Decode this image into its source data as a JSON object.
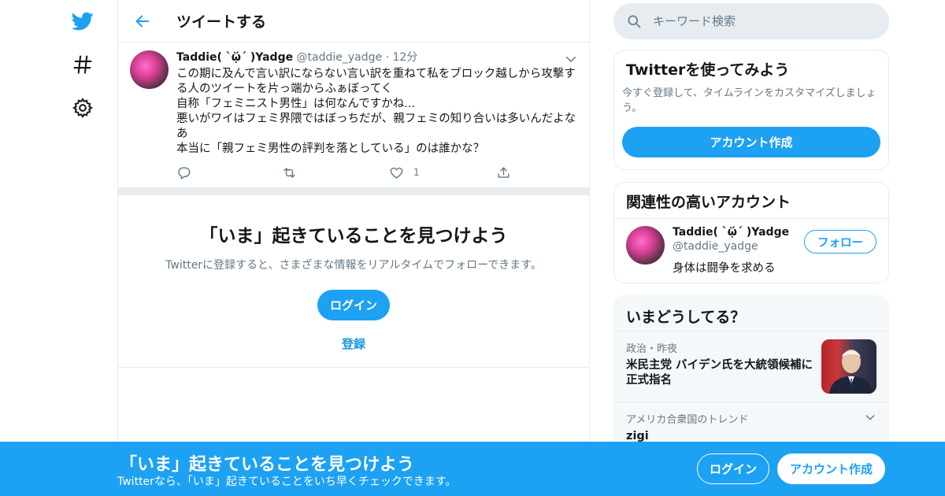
{
  "nav": {
    "icons": [
      "twitter-bird-icon",
      "hashtag-icon",
      "gear-icon"
    ]
  },
  "header": {
    "title": "ツイートする",
    "back_icon": "back-arrow-icon"
  },
  "tweet": {
    "author_name": "Taddie( ˋᾥˊ )Yadge",
    "handle": "@taddie_yadge",
    "separator": "·",
    "time": "12分",
    "lines": [
      "この期に及んで言い訳にならない言い訳を重ねて私をブロック越しから攻撃する人のツイートを片っ端からふぁぼってく",
      "自称「フェミニスト男性」は何なんですかね...",
      "悪いがワイはフェミ界隈ではぼっちだが、親フェミの知り合いは多いんだよなあ",
      "本当に「親フェミ男性の評判を落としている」のは誰かな？"
    ],
    "like_count": "1"
  },
  "discover": {
    "title": "「いま」起きていることを見つけよう",
    "subtitle": "Twitterに登録すると、さまざまな情報をリアルタイムでフォローできます。",
    "login_label": "ログイン",
    "register_label": "登録"
  },
  "search": {
    "placeholder": "キーワード検索"
  },
  "try_card": {
    "title": "Twitterを使ってみよう",
    "text": "今すぐ登録して、タイムラインをカスタマイズしましょう。",
    "button": "アカウント作成"
  },
  "related": {
    "title": "関連性の高いアカウント",
    "name": "Taddie( ˋᾥˊ )Yadge",
    "handle": "@taddie_yadge",
    "bio": "身体は闘争を求める",
    "follow_label": "フォロー"
  },
  "trends": {
    "title": "いまどうしてる？",
    "items": [
      {
        "category": "政治・昨夜",
        "title": "米民主党 バイデン氏を大統領候補に正式指名"
      },
      {
        "category": "アメリカ合衆国のトレンド",
        "title": "zigi"
      }
    ]
  },
  "banner": {
    "title": "「いま」起きていることを見つけよう",
    "subtitle": "Twitterなら、「いま」起きていることをいち早くチェックできます。",
    "login_label": "ログイン",
    "signup_label": "アカウント作成"
  },
  "colors": {
    "accent": "#1da1f2",
    "text": "#14171a",
    "muted": "#657786",
    "border": "#e6ecf0"
  }
}
